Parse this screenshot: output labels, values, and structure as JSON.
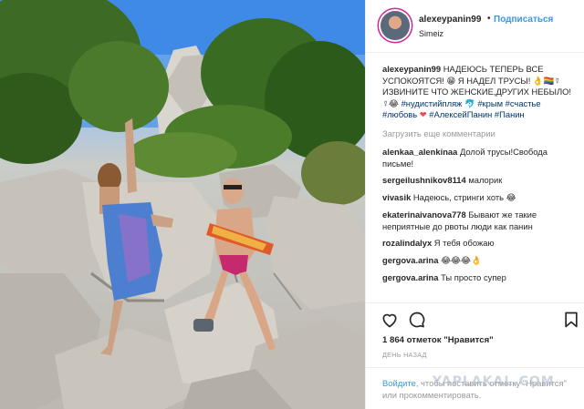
{
  "post": {
    "username": "alexeypanin99",
    "separator": "•",
    "follow_label": "Подписаться",
    "location": "Simeiz",
    "photo_alt": "Photo on rocks at the beach"
  },
  "caption": {
    "username": "alexeypanin99",
    "text_1": " НАДЕЮСЬ ТЕПЕРЬ ВСЕ УСПОКОЯТСЯ! 😁 Я НАДЕЛ ТРУСЫ! 👌🏳️‍🌈☿ ИЗВИНИТЕ ЧТО ЖЕНСКИЕ,ДРУГИХ НЕБЫЛО!☿😂 ",
    "tag_1": "#нудистийпляж",
    "text_2": " 🐬 ",
    "tag_2": "#крым",
    "tag_3": "#счастье",
    "tag_4": "#любовь",
    "heart": "❤",
    "tag_5": "#АлексейПанин",
    "tag_6": "#Панин"
  },
  "load_more_label": "Загрузить еще комментарии",
  "comments": [
    {
      "user": "alenkaa_alenkinaa",
      "text": " Долой трусы!Свобода письме!"
    },
    {
      "user": "sergeilushnikov8114",
      "text": " малорик"
    },
    {
      "user": "vivasik",
      "text": " Надеюсь, стринги хоть 😂"
    },
    {
      "user": "ekaterinaivanova778",
      "text": " Бывают же такие неприятные до рвоты люди как панин"
    },
    {
      "user": "rozalindalyx",
      "text": " Я тебя обожаю"
    },
    {
      "user": "gergova.arina",
      "text": " 😂😂😂👌"
    },
    {
      "user": "gergova.arina",
      "text": " Ты просто супер"
    }
  ],
  "actions": {
    "likes": "1 864 отметок \"Нравится\"",
    "time_ago": "ДЕНЬ НАЗАД",
    "login_link": "Войдите",
    "login_text": ", чтобы поставить отметку \"Нравится\" или прокомментировать."
  },
  "watermark": "YAPLAKAL.COM",
  "colors": {
    "link_blue": "#3897f0",
    "hashtag": "#003569",
    "heart_red": "#ed4956",
    "muted_gray": "#999999"
  },
  "icons": [
    "heart-icon",
    "comment-icon",
    "bookmark-icon"
  ]
}
